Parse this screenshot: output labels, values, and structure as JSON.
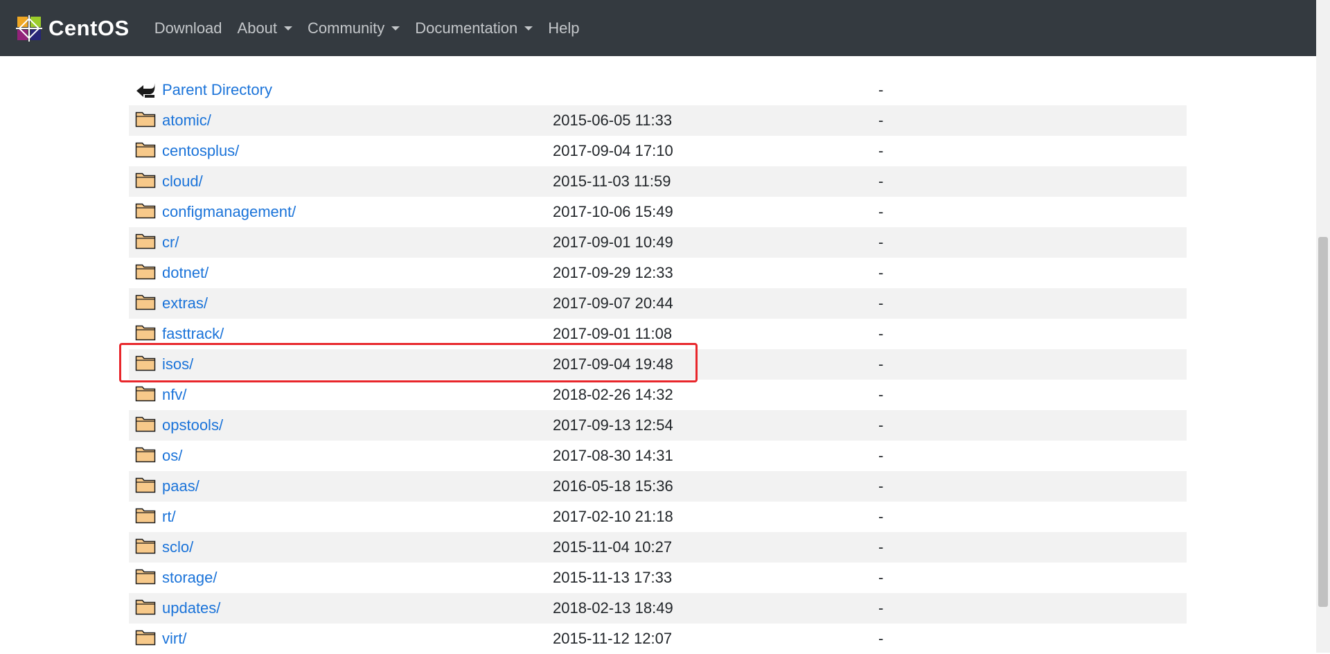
{
  "nav": {
    "brand": "CentOS",
    "items": [
      {
        "label": "Download",
        "dropdown": false
      },
      {
        "label": "About",
        "dropdown": true
      },
      {
        "label": "Community",
        "dropdown": true
      },
      {
        "label": "Documentation",
        "dropdown": true
      },
      {
        "label": "Help",
        "dropdown": false
      }
    ]
  },
  "listing": {
    "parent": {
      "name": "Parent Directory",
      "size": "-"
    },
    "entries": [
      {
        "name": "atomic/",
        "date": "2015-06-05 11:33",
        "size": "-"
      },
      {
        "name": "centosplus/",
        "date": "2017-09-04 17:10",
        "size": "-"
      },
      {
        "name": "cloud/",
        "date": "2015-11-03 11:59",
        "size": "-"
      },
      {
        "name": "configmanagement/",
        "date": "2017-10-06 15:49",
        "size": "-"
      },
      {
        "name": "cr/",
        "date": "2017-09-01 10:49",
        "size": "-"
      },
      {
        "name": "dotnet/",
        "date": "2017-09-29 12:33",
        "size": "-"
      },
      {
        "name": "extras/",
        "date": "2017-09-07 20:44",
        "size": "-"
      },
      {
        "name": "fasttrack/",
        "date": "2017-09-01 11:08",
        "size": "-"
      },
      {
        "name": "isos/",
        "date": "2017-09-04 19:48",
        "size": "-"
      },
      {
        "name": "nfv/",
        "date": "2018-02-26 14:32",
        "size": "-"
      },
      {
        "name": "opstools/",
        "date": "2017-09-13 12:54",
        "size": "-"
      },
      {
        "name": "os/",
        "date": "2017-08-30 14:31",
        "size": "-"
      },
      {
        "name": "paas/",
        "date": "2016-05-18 15:36",
        "size": "-"
      },
      {
        "name": "rt/",
        "date": "2017-02-10 21:18",
        "size": "-"
      },
      {
        "name": "sclo/",
        "date": "2015-11-04 10:27",
        "size": "-"
      },
      {
        "name": "storage/",
        "date": "2015-11-13 17:33",
        "size": "-"
      },
      {
        "name": "updates/",
        "date": "2018-02-13 18:49",
        "size": "-"
      },
      {
        "name": "virt/",
        "date": "2015-11-12 12:07",
        "size": "-"
      }
    ]
  },
  "icons": {
    "logo": "centos-logo-icon",
    "parent": "back-arrow-icon",
    "folder": "folder-icon"
  },
  "colors": {
    "navbar": "#343a40",
    "link": "#1a73d9",
    "highlight": "#e8262b",
    "row_alt": "#f2f2f2"
  },
  "highlighted_entry": "isos/"
}
